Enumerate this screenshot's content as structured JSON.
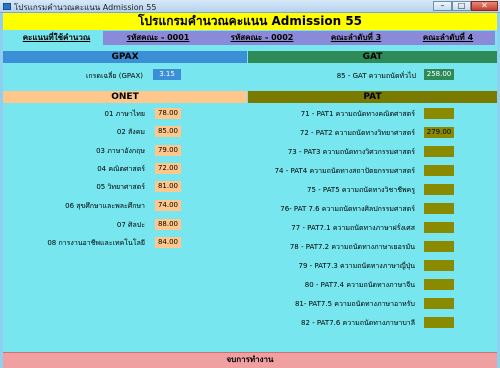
{
  "window": {
    "title": "โปรแกรมคำนวณคะแนน Admission 55",
    "min": "–",
    "max": "□",
    "close": "✕"
  },
  "header": {
    "title": "โปรแกรมคำนวณคะแนน Admission 55"
  },
  "tabs": [
    {
      "label": "คะแนนที่ใช้คำนวณ"
    },
    {
      "label": "รหัสคณะ - 0001"
    },
    {
      "label": "รหัสคณะ - 0002"
    },
    {
      "label": "คณะลำดับที่ 3"
    },
    {
      "label": "คณะลำดับที่ 4"
    }
  ],
  "gpax": {
    "title": "GPAX",
    "label": "เกรดเฉลี่ย (GPAX)",
    "value": "3.15"
  },
  "gat": {
    "title": "GAT",
    "label": "85 - GAT ความถนัดทั่วไป",
    "value": "258.00"
  },
  "onet": {
    "title": "ONET",
    "items": [
      {
        "label": "01 ภาษาไทย",
        "value": "78.00"
      },
      {
        "label": "02 สังคม",
        "value": "85.00"
      },
      {
        "label": "03 ภาษาอังกฤษ",
        "value": "79.00"
      },
      {
        "label": "04 คณิตศาสตร์",
        "value": "72.00"
      },
      {
        "label": "05 วิทยาศาสตร์",
        "value": "81.00"
      },
      {
        "label": "06 สุขศึกษาและพละศึกษา",
        "value": "74.00"
      },
      {
        "label": "07 ศิลปะ",
        "value": "88.00"
      },
      {
        "label": "08 การงานอาชีพและเทคโนโลยี",
        "value": "84.00"
      }
    ]
  },
  "pat": {
    "title": "PAT",
    "items": [
      {
        "label": "71 - PAT1 ความถนัดทางคณิตศาสตร์",
        "value": ""
      },
      {
        "label": "72 - PAT2 ความถนัดทางวิทยาศาสตร์",
        "value": "279.00"
      },
      {
        "label": "73 - PAT3 ความถนัดทางวิศวกรรมศาสตร์",
        "value": ""
      },
      {
        "label": "74 - PAT4 ความถนัดทางสถาปัตยกรรมศาสตร์",
        "value": ""
      },
      {
        "label": "75 - PAT5 ความถนัดทางวิชาชีพครู",
        "value": ""
      },
      {
        "label": "76- PAT 7.6 ความถนัดทางศิลปกรรมศาสตร์",
        "value": ""
      },
      {
        "label": "77 - PAT7.1 ความถนัดทางภาษาฝรั่งเศส",
        "value": ""
      },
      {
        "label": "78 - PAT7.2 ความถนัดทางภาษาเยอรมัน",
        "value": ""
      },
      {
        "label": "79 - PAT7.3 ความถนัดทางภาษาญี่ปุ่น",
        "value": ""
      },
      {
        "label": "80 - PAT7.4 ความถนัดทางภาษาจีน",
        "value": ""
      },
      {
        "label": "81- PAT7.5 ความถนัดทางภาษาอาหรับ",
        "value": ""
      },
      {
        "label": "82 - PAT7.6 ความถนัดทางภาษาบาลี",
        "value": ""
      }
    ]
  },
  "footer": {
    "label": "จบการทำงาน"
  },
  "colors": {
    "frame": "#78e6ef",
    "header": "#ffff00",
    "gpax": "#3b8fd6",
    "gat": "#2e8b57",
    "onet": "#ffc78c",
    "pat": "#7a7a00",
    "onet_value": "#ffc78c",
    "pat_value": "#8a8a00",
    "gpax_value": "#3b8fd6",
    "gat_value": "#2e8b57",
    "footer": "#f0a0a0"
  }
}
